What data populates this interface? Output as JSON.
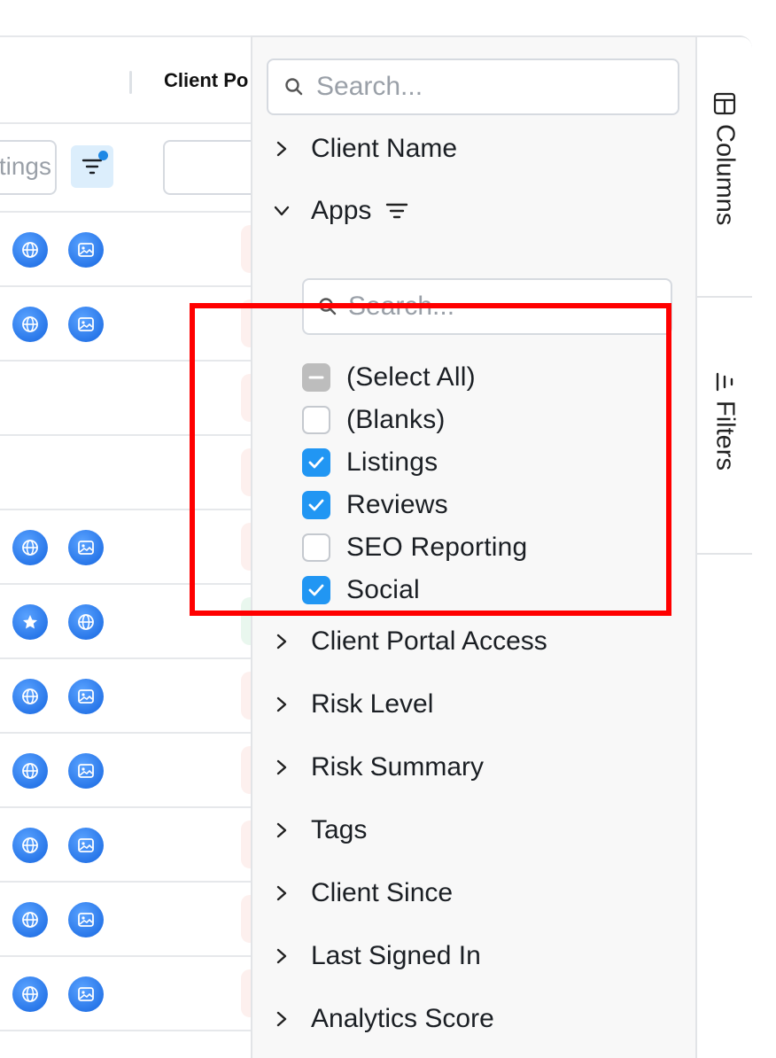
{
  "grid": {
    "column_title": "Client Po",
    "floating_filter_value": "tings",
    "row_icons": [
      [
        "globe",
        "image"
      ],
      [
        "globe",
        "image"
      ],
      [],
      [],
      [
        "globe",
        "image"
      ],
      [
        "star",
        "globe"
      ],
      [
        "globe",
        "image"
      ],
      [
        "globe",
        "image"
      ],
      [
        "globe",
        "image"
      ],
      [
        "globe",
        "image"
      ],
      [
        "globe",
        "image"
      ]
    ]
  },
  "panel": {
    "search_placeholder": "Search...",
    "groups_before": [
      {
        "label": "Client Name",
        "expanded": false
      },
      {
        "label": "Apps",
        "expanded": true
      }
    ],
    "apps_filter": {
      "search_placeholder": "Search...",
      "options": [
        {
          "label": "(Select All)",
          "state": "partial"
        },
        {
          "label": "(Blanks)",
          "state": "unchecked"
        },
        {
          "label": "Listings",
          "state": "checked"
        },
        {
          "label": "Reviews",
          "state": "checked"
        },
        {
          "label": "SEO Reporting",
          "state": "unchecked"
        },
        {
          "label": "Social",
          "state": "checked"
        }
      ]
    },
    "groups_after": [
      {
        "label": "Client Portal Access"
      },
      {
        "label": "Risk Level"
      },
      {
        "label": "Risk Summary"
      },
      {
        "label": "Tags"
      },
      {
        "label": "Client Since"
      },
      {
        "label": "Last Signed In"
      },
      {
        "label": "Analytics Score"
      }
    ]
  },
  "tabs": {
    "columns": "Columns",
    "filters": "Filters"
  },
  "colors": {
    "accent": "#2196f3",
    "highlight": "#ff0000",
    "app_icon": "#1565e0"
  }
}
